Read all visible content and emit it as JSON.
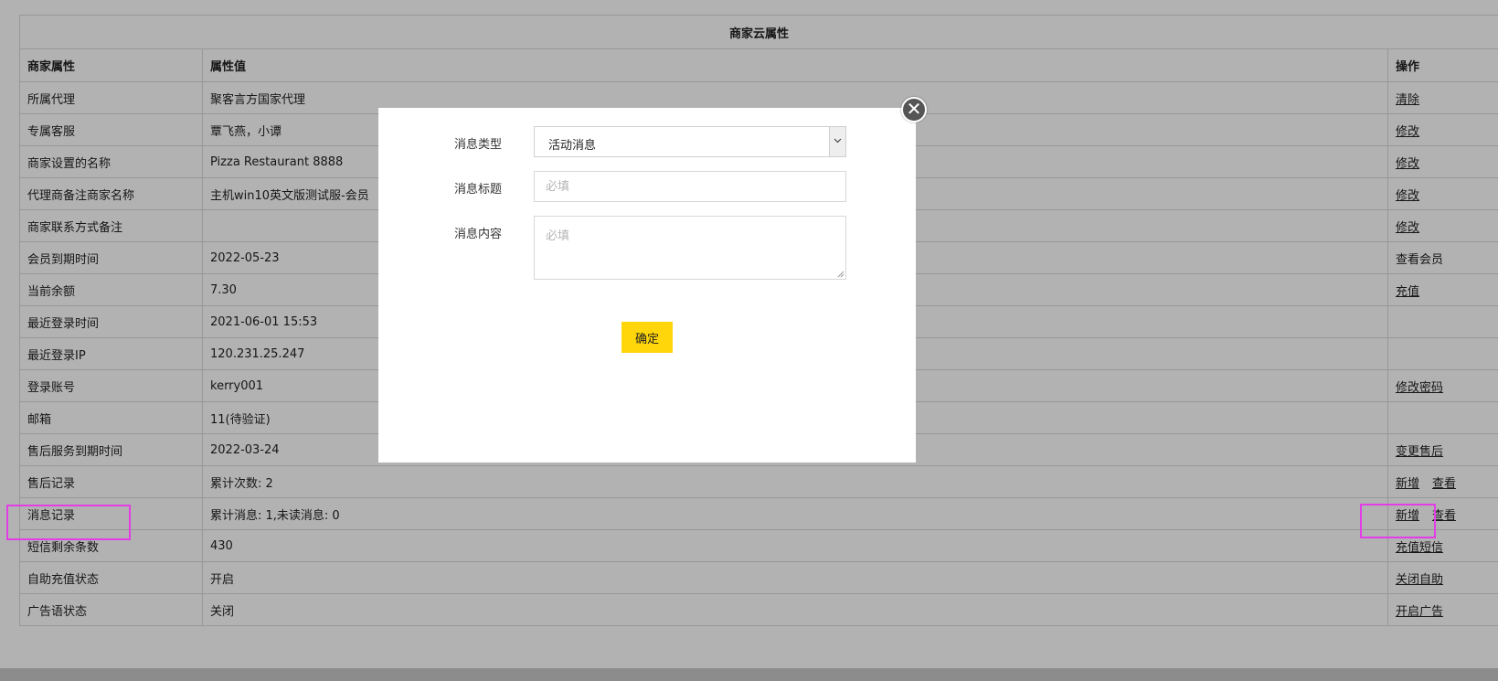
{
  "table": {
    "title": "商家云属性",
    "headers": [
      "商家属性",
      "属性值",
      "操作"
    ],
    "rows": [
      {
        "label": "所属代理",
        "value": "聚客言方国家代理",
        "ops": [
          "清除"
        ]
      },
      {
        "label": "专属客服",
        "value": "覃飞燕，小谭",
        "ops": [
          "修改"
        ]
      },
      {
        "label": "商家设置的名称",
        "value": "Pizza Restaurant 8888",
        "ops": [
          "修改"
        ]
      },
      {
        "label": "代理商备注商家名称",
        "value": "主机win10英文版测试服-会员",
        "ops": [
          "修改"
        ]
      },
      {
        "label": "商家联系方式备注",
        "value": "",
        "ops": [
          "修改"
        ]
      },
      {
        "label": "会员到期时间",
        "value": "2022-05-23",
        "ops": [],
        "op_text": "查看会员"
      },
      {
        "label": "当前余额",
        "value": "7.30",
        "ops": [
          "充值"
        ]
      },
      {
        "label": "最近登录时间",
        "value": "2021-06-01 15:53",
        "ops": []
      },
      {
        "label": "最近登录IP",
        "value": "120.231.25.247",
        "ops": []
      },
      {
        "label": "登录账号",
        "value": "kerry001",
        "ops": [
          "修改密码"
        ]
      },
      {
        "label": "邮箱",
        "value": "11(待验证)",
        "ops": []
      },
      {
        "label": "售后服务到期时间",
        "value": "2022-03-24",
        "ops": [
          "变更售后"
        ]
      },
      {
        "label": "售后记录",
        "value": "累计次数: 2",
        "ops": [
          "新增",
          "查看"
        ]
      },
      {
        "label": "消息记录",
        "value": "累计消息: 1,未读消息: 0",
        "ops": [
          "新增",
          "查看"
        ]
      },
      {
        "label": "短信剩余条数",
        "value": "430",
        "ops": [
          "充值短信"
        ]
      },
      {
        "label": "自助充值状态",
        "value": "开启",
        "ops": [
          "关闭自助"
        ]
      },
      {
        "label": "广告语状态",
        "value": "关闭",
        "ops": [
          "开启广告"
        ]
      }
    ]
  },
  "modal": {
    "type_label": "消息类型",
    "type_value": "活动消息",
    "title_label": "消息标题",
    "title_placeholder": "必填",
    "content_label": "消息内容",
    "content_placeholder": "必填",
    "confirm_label": "确定",
    "close_symbol": "✕"
  },
  "icons": {
    "close": "close-icon",
    "select_arrow": "chevron-down-icon"
  },
  "colors": {
    "confirm_button": "#ffd60a",
    "highlight": "#e33ee6"
  }
}
